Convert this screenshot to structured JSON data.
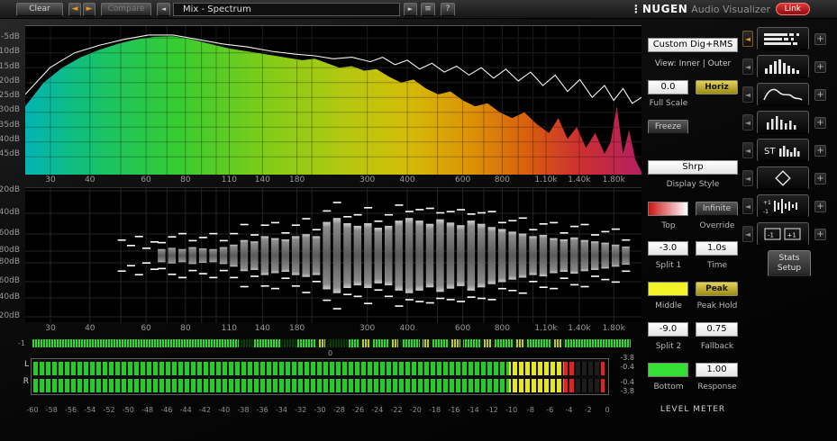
{
  "toolbar": {
    "clear": "Clear",
    "prev_arrow": "◄",
    "next_arrow": "►",
    "compare": "Compare",
    "preset_arrow": "◄",
    "preset": "Mix - Spectrum",
    "play": "►",
    "list": "≡",
    "help": "?",
    "brand_dots": "⋮",
    "brand": "NUGEN",
    "brand_suffix": "Audio Visualizer",
    "link": "Link"
  },
  "freq_axis": {
    "labels": [
      {
        "t": "30",
        "p": 0.041
      },
      {
        "t": "40",
        "p": 0.105
      },
      {
        "t": "60",
        "p": 0.196
      },
      {
        "t": "80",
        "p": 0.26
      },
      {
        "t": "110",
        "p": 0.331
      },
      {
        "t": "140",
        "p": 0.385
      },
      {
        "t": "180",
        "p": 0.441
      },
      {
        "t": "300",
        "p": 0.555
      },
      {
        "t": "400",
        "p": 0.62
      },
      {
        "t": "600",
        "p": 0.71
      },
      {
        "t": "800",
        "p": 0.774
      },
      {
        "t": "1.10k",
        "p": 0.845
      },
      {
        "t": "1.40k",
        "p": 0.899
      },
      {
        "t": "1.80k",
        "p": 0.955
      }
    ],
    "grid": [
      0.041,
      0.105,
      0.155,
      0.196,
      0.23,
      0.26,
      0.286,
      0.31,
      0.331,
      0.385,
      0.441,
      0.465,
      0.555,
      0.62,
      0.669,
      0.71,
      0.744,
      0.774,
      0.8,
      0.824,
      0.845,
      0.899,
      0.955
    ]
  },
  "spectrum": {
    "y_labels": [
      "-5dB",
      "-10dB",
      "-15dB",
      "-20dB",
      "-25dB",
      "-30dB",
      "-35dB",
      "-40dB",
      "-45dB"
    ],
    "gradient": [
      [
        "0%",
        "#00b4b4"
      ],
      [
        "12%",
        "#18c268"
      ],
      [
        "25%",
        "#38cc30"
      ],
      [
        "40%",
        "#84cc18"
      ],
      [
        "52%",
        "#b4c810"
      ],
      [
        "62%",
        "#d4bc08"
      ],
      [
        "72%",
        "#dc9406"
      ],
      [
        "82%",
        "#d85c10"
      ],
      [
        "90%",
        "#cc3030"
      ],
      [
        "100%",
        "#b42060"
      ]
    ],
    "fill_db": [
      [
        0,
        -28
      ],
      [
        0.03,
        -20
      ],
      [
        0.06,
        -15
      ],
      [
        0.09,
        -11.5
      ],
      [
        0.12,
        -9
      ],
      [
        0.15,
        -7
      ],
      [
        0.18,
        -5.5
      ],
      [
        0.21,
        -4.6
      ],
      [
        0.24,
        -4.4
      ],
      [
        0.27,
        -5.5
      ],
      [
        0.3,
        -7
      ],
      [
        0.33,
        -8.5
      ],
      [
        0.36,
        -9.5
      ],
      [
        0.39,
        -10.5
      ],
      [
        0.42,
        -11.5
      ],
      [
        0.45,
        -12.5
      ],
      [
        0.47,
        -12
      ],
      [
        0.49,
        -13.5
      ],
      [
        0.51,
        -15
      ],
      [
        0.53,
        -14.5
      ],
      [
        0.55,
        -16
      ],
      [
        0.57,
        -15.5
      ],
      [
        0.59,
        -18
      ],
      [
        0.61,
        -20
      ],
      [
        0.63,
        -19
      ],
      [
        0.65,
        -22
      ],
      [
        0.67,
        -24
      ],
      [
        0.69,
        -23
      ],
      [
        0.71,
        -26
      ],
      [
        0.73,
        -28
      ],
      [
        0.75,
        -27
      ],
      [
        0.77,
        -30
      ],
      [
        0.79,
        -32
      ],
      [
        0.81,
        -30
      ],
      [
        0.83,
        -34
      ],
      [
        0.85,
        -37
      ],
      [
        0.865,
        -32
      ],
      [
        0.88,
        -39
      ],
      [
        0.895,
        -35
      ],
      [
        0.91,
        -42
      ],
      [
        0.925,
        -37
      ],
      [
        0.94,
        -44
      ],
      [
        0.95,
        -40
      ],
      [
        0.96,
        -28
      ],
      [
        0.97,
        -44
      ],
      [
        0.98,
        -36
      ],
      [
        0.99,
        -46
      ],
      [
        1,
        -50
      ]
    ],
    "line_db": [
      [
        0,
        -24
      ],
      [
        0.04,
        -15
      ],
      [
        0.08,
        -10
      ],
      [
        0.12,
        -7.5
      ],
      [
        0.16,
        -5.5
      ],
      [
        0.2,
        -4
      ],
      [
        0.24,
        -4
      ],
      [
        0.28,
        -5.5
      ],
      [
        0.32,
        -7
      ],
      [
        0.36,
        -8
      ],
      [
        0.4,
        -9.5
      ],
      [
        0.44,
        -10.5
      ],
      [
        0.47,
        -11
      ],
      [
        0.5,
        -12
      ],
      [
        0.53,
        -11.5
      ],
      [
        0.56,
        -13
      ],
      [
        0.58,
        -11.5
      ],
      [
        0.6,
        -14
      ],
      [
        0.62,
        -12.5
      ],
      [
        0.64,
        -15.5
      ],
      [
        0.66,
        -13.5
      ],
      [
        0.68,
        -16.5
      ],
      [
        0.7,
        -14.5
      ],
      [
        0.72,
        -17.5
      ],
      [
        0.74,
        -15
      ],
      [
        0.76,
        -18.5
      ],
      [
        0.78,
        -15.5
      ],
      [
        0.8,
        -19.5
      ],
      [
        0.82,
        -16.5
      ],
      [
        0.84,
        -21
      ],
      [
        0.86,
        -17.5
      ],
      [
        0.88,
        -23
      ],
      [
        0.9,
        -19
      ],
      [
        0.92,
        -25
      ],
      [
        0.94,
        -21
      ],
      [
        0.955,
        -26
      ],
      [
        0.97,
        -22
      ],
      [
        0.985,
        -27
      ],
      [
        1,
        -25
      ]
    ]
  },
  "histogram": {
    "y_labels": [
      "-20dB",
      "-40dB",
      "-60dB",
      "-80dB",
      "-80dB",
      "-60dB",
      "-40dB",
      "-20dB"
    ],
    "bars": [
      0.1,
      0.12,
      0.1,
      0.13,
      0.11,
      0.1,
      0.13,
      0.17,
      0.24,
      0.22,
      0.3,
      0.27,
      0.25,
      0.3,
      0.33,
      0.3,
      0.52,
      0.58,
      0.5,
      0.46,
      0.5,
      0.43,
      0.46,
      0.54,
      0.58,
      0.54,
      0.49,
      0.56,
      0.51,
      0.47,
      0.54,
      0.49,
      0.44,
      0.41,
      0.37,
      0.34,
      0.3,
      0.32,
      0.27,
      0.25,
      0.28,
      0.24,
      0.22,
      0.2,
      0.17,
      0.14
    ],
    "extra_dashes": [
      [
        0.15,
        18
      ],
      [
        0.165,
        12
      ],
      [
        0.178,
        22
      ],
      [
        0.19,
        9
      ],
      [
        0.203,
        16
      ]
    ]
  },
  "correlation": {
    "left_label": "-1",
    "center_label": "0",
    "colors": {
      "g": "#2bd82b",
      "y": "#b9c92a",
      "d": "#0b3a0b"
    },
    "segments": [
      [
        0.0,
        0.345,
        "g"
      ],
      [
        0.35,
        0.018,
        "d"
      ],
      [
        0.37,
        0.045,
        "g"
      ],
      [
        0.42,
        0.02,
        "d"
      ],
      [
        0.443,
        0.03,
        "g"
      ],
      [
        0.478,
        0.012,
        "y"
      ],
      [
        0.495,
        0.03,
        "d"
      ],
      [
        0.528,
        0.018,
        "g"
      ],
      [
        0.55,
        0.015,
        "y"
      ],
      [
        0.57,
        0.025,
        "g"
      ],
      [
        0.6,
        0.012,
        "y"
      ],
      [
        0.617,
        0.03,
        "g"
      ],
      [
        0.652,
        0.012,
        "y"
      ],
      [
        0.668,
        0.028,
        "g"
      ],
      [
        0.7,
        0.015,
        "y"
      ],
      [
        0.72,
        0.03,
        "g"
      ],
      [
        0.755,
        0.012,
        "y"
      ],
      [
        0.772,
        0.03,
        "g"
      ],
      [
        0.807,
        0.015,
        "y"
      ],
      [
        0.827,
        0.04,
        "g"
      ],
      [
        0.872,
        0.012,
        "y"
      ],
      [
        0.888,
        0.112,
        "g"
      ]
    ]
  },
  "level_meter": {
    "channels": [
      "L",
      "R"
    ],
    "scale": [
      "-60",
      "-58",
      "-56",
      "-54",
      "-52",
      "-50",
      "-48",
      "-46",
      "-44",
      "-42",
      "-40",
      "-38",
      "-36",
      "-34",
      "-32",
      "-30",
      "-28",
      "-26",
      "-24",
      "-22",
      "-20",
      "-18",
      "-16",
      "-14",
      "-12",
      "-10",
      "-8",
      "-6",
      "-4",
      "-2",
      "0"
    ],
    "segments": [
      {
        "to": 0.83,
        "color": "#25cc25"
      },
      {
        "to": 0.925,
        "color": "#e6e626"
      },
      {
        "to": 0.946,
        "color": "#e02222"
      },
      {
        "to": 1.0,
        "color": "#1d1d1d"
      }
    ],
    "peak_position": 0.988,
    "peak_color": "#e02222",
    "values": [
      "-3.8",
      "-0.4",
      "-0.4",
      "-3.8"
    ],
    "title": "LEVEL METER"
  },
  "controls": {
    "mode": "Custom Dig+RMS",
    "view": "View: Inner | Outer",
    "full_scale_value": "0.0",
    "full_scale_label": "Full Scale",
    "horiz": "Horiz",
    "freeze": "Freeze",
    "display_style_value": "Shrp",
    "display_style_label": "Display Style",
    "top_label": "Top",
    "override_button": "Infinite",
    "override_label": "Override",
    "split1_value": "-3.0",
    "split1_label": "Split 1",
    "time_value": "1.0s",
    "time_label": "Time",
    "middle_label": "Middle",
    "peak_button": "Peak",
    "peak_label": "Peak Hold",
    "split2_value": "-9.0",
    "split2_label": "Split 2",
    "fallback_value": "0.75",
    "fallback_label": "Fallback",
    "bottom_label": "Bottom",
    "response_value": "1.00",
    "response_label": "Response",
    "top_swatch": [
      "#cc1414",
      "#ffffff"
    ],
    "middle_swatch": "#f2f22a",
    "bottom_swatch": "#35e035"
  },
  "view_column": {
    "arrow": "◄",
    "plus": "+",
    "stats_label": "Stats Setup",
    "buttons": [
      {
        "name": "level-meter",
        "icon": "meter-lines",
        "selected": true
      },
      {
        "name": "spectrum-bars",
        "icon": "bars",
        "selected": false
      },
      {
        "name": "spectrum-line",
        "icon": "curve",
        "selected": false
      },
      {
        "name": "spectrum-small",
        "icon": "small-bars",
        "selected": false
      },
      {
        "name": "stereo-spectrum",
        "icon": "st-bars",
        "selected": false
      },
      {
        "name": "vectorscope",
        "icon": "diamond",
        "selected": false
      },
      {
        "name": "correlation-history",
        "icon": "corr-hist",
        "selected": false
      },
      {
        "name": "correlation-meter",
        "icon": "corr-meter",
        "selected": false
      }
    ]
  }
}
